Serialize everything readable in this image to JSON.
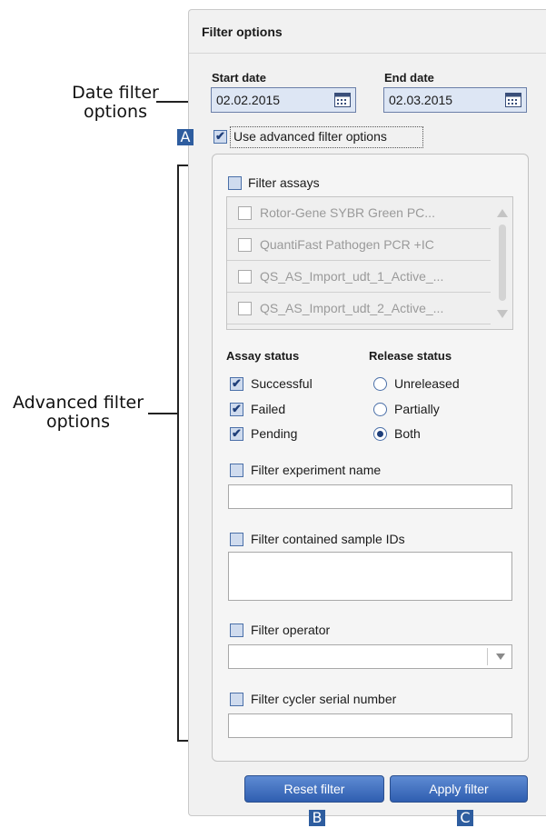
{
  "callouts": {
    "date": [
      "Date filter",
      "options"
    ],
    "advanced": [
      "Advanced filter",
      "options"
    ],
    "badge_a": "A",
    "badge_b": "B",
    "badge_c": "C"
  },
  "panel": {
    "title": "Filter options",
    "start_date": {
      "label": "Start date",
      "value": "02.02.2015"
    },
    "end_date": {
      "label": "End date",
      "value": "02.03.2015"
    },
    "use_advanced": {
      "label": "Use advanced filter options",
      "checked": true
    },
    "filter_assays": {
      "label": "Filter assays",
      "checked": false,
      "items": [
        "Rotor-Gene SYBR Green PC...",
        "QuantiFast Pathogen PCR +IC",
        "QS_AS_Import_udt_1_Active_...",
        "QS_AS_Import_udt_2_Active_..."
      ]
    },
    "assay_status": {
      "label": "Assay status",
      "options": [
        {
          "label": "Successful",
          "checked": true
        },
        {
          "label": "Failed",
          "checked": true
        },
        {
          "label": "Pending",
          "checked": true
        }
      ]
    },
    "release_status": {
      "label": "Release status",
      "options": [
        {
          "label": "Unreleased",
          "selected": false
        },
        {
          "label": "Partially",
          "selected": false
        },
        {
          "label": "Both",
          "selected": true
        }
      ]
    },
    "filter_experiment_name": {
      "label": "Filter experiment name",
      "value": ""
    },
    "filter_sample_ids": {
      "label": "Filter contained sample IDs",
      "value": ""
    },
    "filter_operator": {
      "label": "Filter operator",
      "value": ""
    },
    "filter_cycler": {
      "label": "Filter cycler serial number",
      "value": ""
    },
    "reset_label": "Reset filter",
    "apply_label": "Apply filter"
  },
  "colors": {
    "accent": "#2e5d9f",
    "button": "#3f6fc0"
  }
}
